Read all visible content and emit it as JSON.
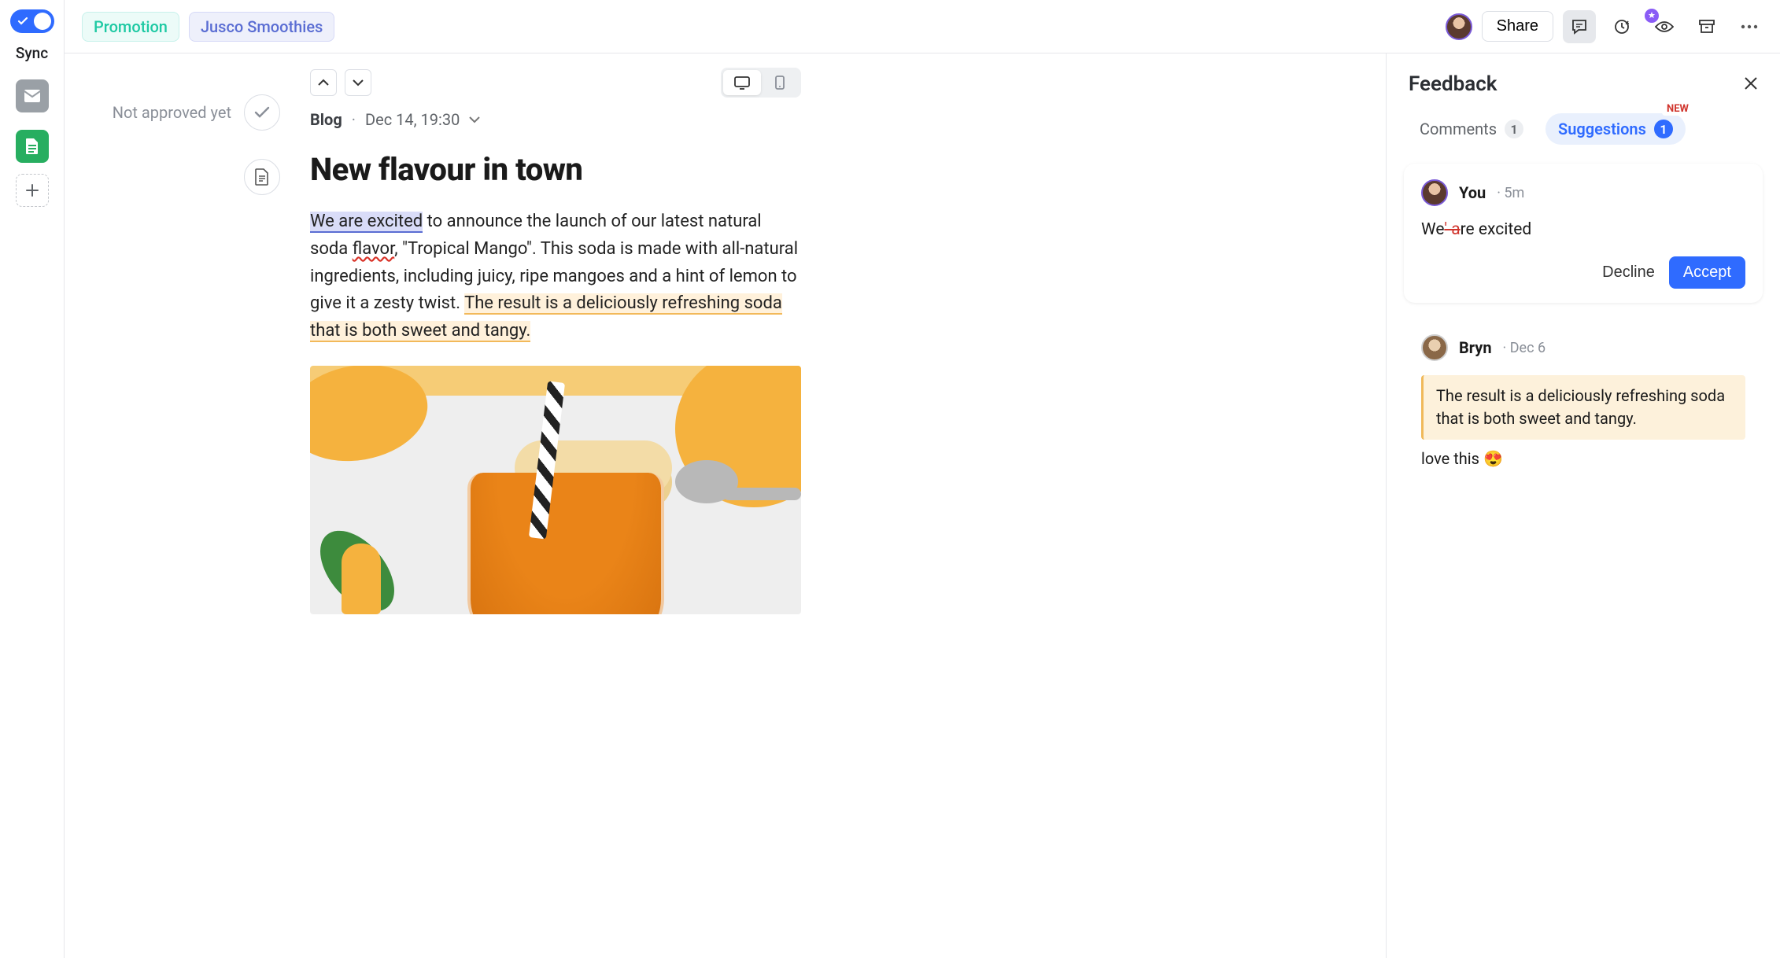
{
  "sync": {
    "label": "Sync"
  },
  "tags": {
    "promotion": "Promotion",
    "jusco": "Jusco Smoothies"
  },
  "topbar": {
    "share": "Share"
  },
  "status": {
    "not_approved": "Not approved yet"
  },
  "meta": {
    "channel": "Blog",
    "date": "Dec 14, 19:30"
  },
  "post": {
    "title": "New flavour in town",
    "p1_span_highlight": "We are excited",
    "p1_part2": " to announce the launch of our latest natural soda ",
    "p1_flavor": "flavor",
    "p1_part3": ", \"Tropical Mango\". This soda is made with all-natural ingredients, including juicy, ripe mangoes and a hint of lemon to give it a zesty twist. ",
    "p1_comment_span": "The result is a deliciously refreshing soda that is both sweet and tangy."
  },
  "feedback": {
    "title": "Feedback",
    "tab_comments": "Comments",
    "tab_comments_count": "1",
    "tab_suggestions": "Suggestions",
    "tab_suggestions_count": "1",
    "new_badge": "NEW"
  },
  "suggestion_card": {
    "author": "You",
    "time": "5m",
    "text_before": "We",
    "text_strike": "' a",
    "text_after": "re excited",
    "decline": "Decline",
    "accept": "Accept"
  },
  "comment_card": {
    "author": "Bryn",
    "time": "Dec 6",
    "quote": "The result is a deliciously refreshing soda that is both sweet and tangy.",
    "text": "love this 😍"
  }
}
